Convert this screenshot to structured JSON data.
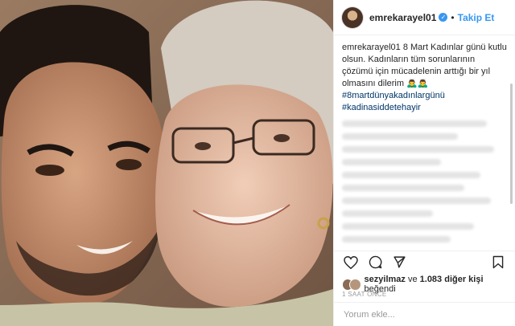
{
  "header": {
    "username": "emrekarayel01",
    "follow_label": "Takip Et",
    "separator": "•"
  },
  "caption": {
    "username": "emrekarayel01",
    "text": " 8 Mart Kadınlar günü kutlu olsun. Kadınların tüm sorunlarının çözümü için mücadelenin arttığı bir yıl olmasını dilerim 🙇‍♂️🙇‍♂️",
    "hashtags": [
      "#8martdünyakadınlargünü",
      "#kadinasiddetehayir"
    ]
  },
  "likes": {
    "user": "sezyilmaz",
    "connector": " ve ",
    "count_text": "1.083 diğer kişi",
    "suffix": " beğendi"
  },
  "timestamp": "1 SAAT ÖNCE",
  "add_comment": {
    "placeholder": "Yorum ekle..."
  },
  "colors": {
    "link": "#3897f0",
    "hashtag": "#003569",
    "text": "#262626"
  }
}
